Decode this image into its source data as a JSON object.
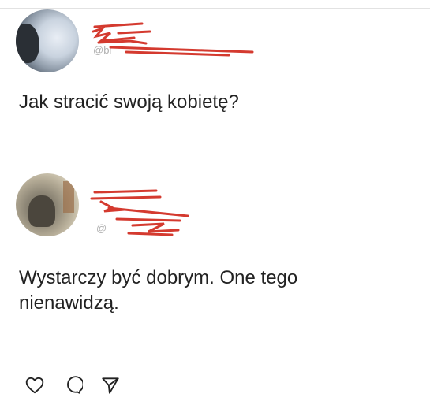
{
  "posts": [
    {
      "handle": "@bl",
      "text": "Jak stracić swoją kobietę?"
    },
    {
      "handle": "@",
      "text": "Wystarczy być dobrym. One tego nienawidzą."
    }
  ],
  "actions": {
    "like": "heart-icon",
    "comment": "comment-icon",
    "share": "send-icon"
  },
  "colors": {
    "redaction": "#d43a2f",
    "text": "#222222",
    "handle": "#b0b0b0"
  }
}
